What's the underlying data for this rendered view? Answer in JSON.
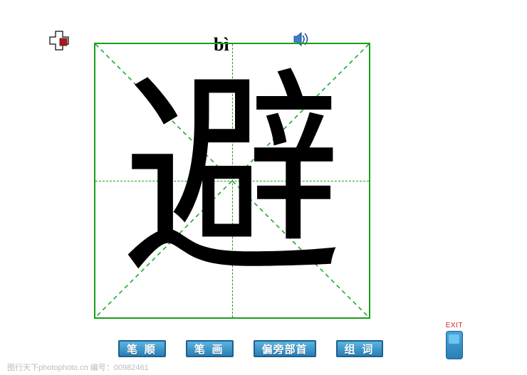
{
  "pinyin": "bì",
  "character": "避",
  "buttons": {
    "stroke_order": "笔 顺",
    "strokes": "笔 画",
    "radical": "偏旁部首",
    "words": "组 词"
  },
  "exit_label": "EXIT",
  "watermark": "图行天下photophoto.cn  编号：00982461",
  "icons": {
    "cursor": "cursor-tool-icon",
    "speaker": "speaker-icon",
    "exit_device": "exit-device-icon"
  }
}
